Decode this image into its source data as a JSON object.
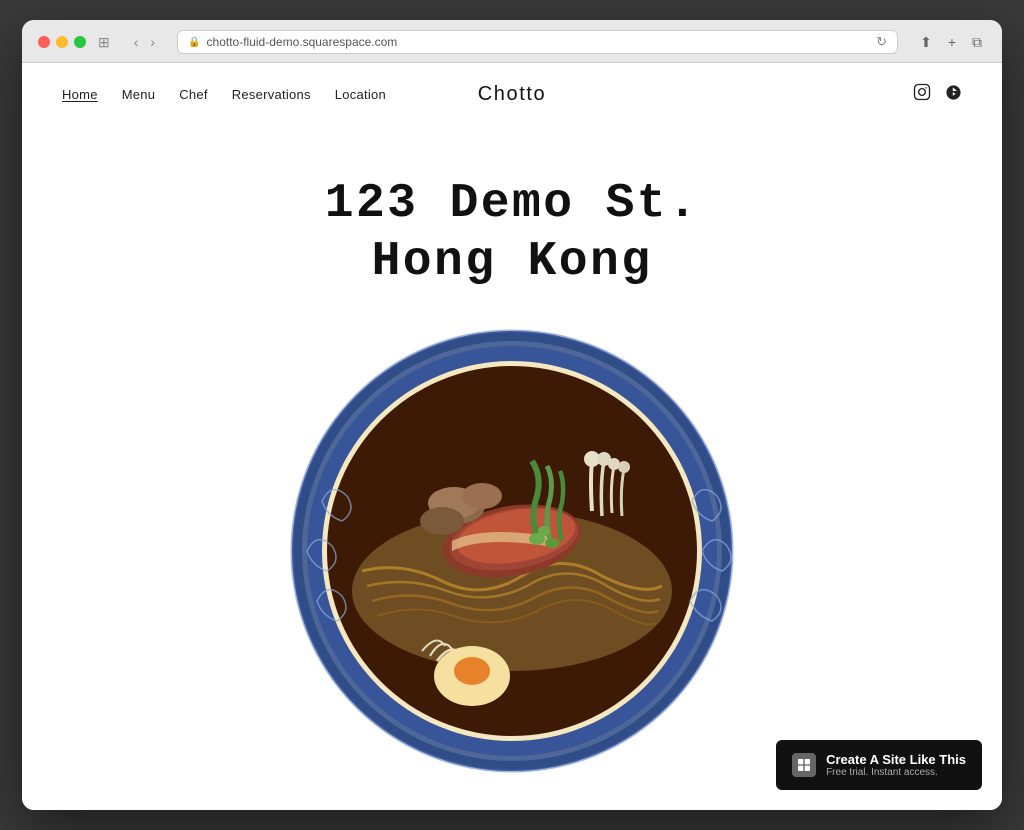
{
  "browser": {
    "url": "chotto-fluid-demo.squarespace.com",
    "back_btn": "‹",
    "forward_btn": "›",
    "reload_btn": "↻",
    "share_btn": "⬆",
    "new_tab_btn": "+",
    "tabs_btn": "⧉"
  },
  "nav": {
    "links": [
      {
        "label": "Home",
        "active": true
      },
      {
        "label": "Menu",
        "active": false
      },
      {
        "label": "Chef",
        "active": false
      },
      {
        "label": "Reservations",
        "active": false
      },
      {
        "label": "Location",
        "active": false
      }
    ],
    "site_title": "Chotto",
    "social": [
      {
        "name": "instagram",
        "symbol": "⊙"
      },
      {
        "name": "yelp",
        "symbol": "❋"
      }
    ]
  },
  "hero": {
    "line1": "123 Demo St.",
    "line2": "Hong Kong"
  },
  "squarespace_banner": {
    "logo_text": "◈",
    "main_text": "Create A Site Like This",
    "sub_text": "Free trial. Instant access."
  }
}
